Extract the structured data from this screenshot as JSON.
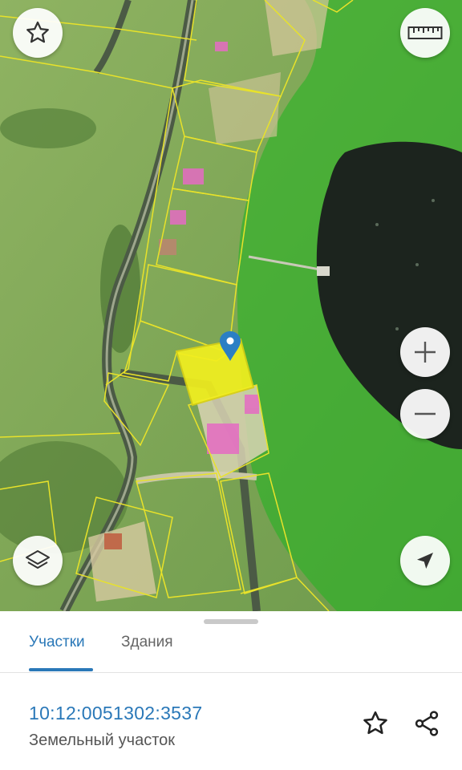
{
  "map": {
    "buttons": {
      "favorite": "star-icon",
      "ruler": "ruler-icon",
      "zoom_in": "plus-icon",
      "zoom_out": "minus-icon",
      "layers": "layers-icon",
      "locate": "navigation-arrow-icon"
    },
    "colors": {
      "protected_zone": "#1fb51f",
      "parcel_outline": "#e8e22a",
      "selected_parcel": "#f2ef1f",
      "marker": "#2b7fc4"
    }
  },
  "sheet": {
    "tabs": [
      {
        "label": "Участки",
        "active": true
      },
      {
        "label": "Здания",
        "active": false
      }
    ],
    "parcel": {
      "cadastral_number": "10:12:0051302:3537",
      "type": "Земельный участок"
    },
    "accent_color": "#2a78b8"
  }
}
